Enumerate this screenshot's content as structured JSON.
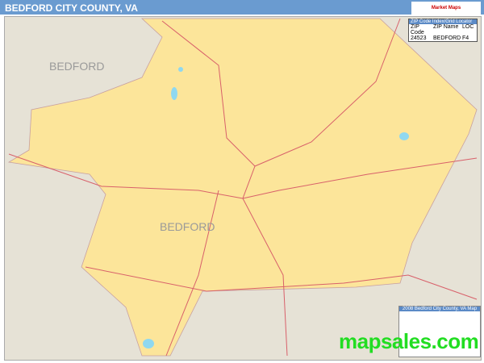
{
  "title": "BEDFORD CITY COUNTY, VA",
  "logo": "Market Maps",
  "labels": {
    "outer": "BEDFORD",
    "city": "BEDFORD"
  },
  "zip_locator": {
    "title": "ZIP Code Index/Grid Locator",
    "headers": [
      "ZIP Code",
      "ZIP Name",
      "LOC"
    ],
    "rows": [
      [
        "24523",
        "BEDFORD",
        "F4"
      ]
    ]
  },
  "legend": {
    "title": "2008 Bedford City County, VA Map"
  },
  "brand": "mapsales.com",
  "colors": {
    "land": "#fce59a",
    "outside": "#e6e2d6",
    "roads": "#d8606a",
    "water": "#8fd8f0",
    "header": "#6a9bd0",
    "brand": "#22dd22"
  }
}
